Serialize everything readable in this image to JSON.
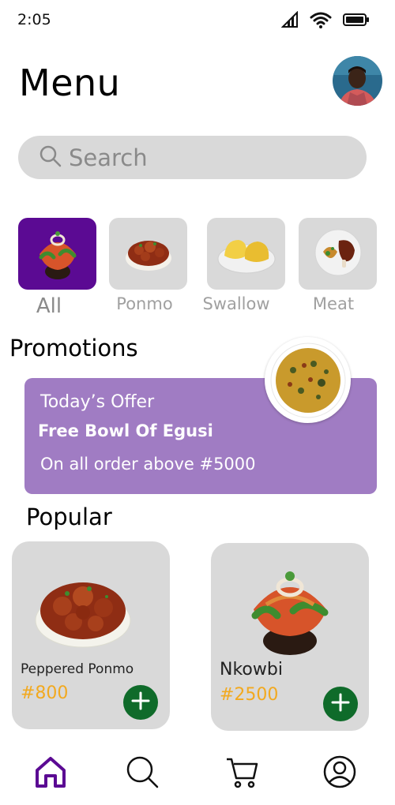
{
  "status_bar": {
    "time": "2:05",
    "icons": [
      "signal-icon",
      "wifi-icon",
      "battery-icon"
    ]
  },
  "header": {
    "title": "Menu",
    "avatar": "user-avatar"
  },
  "search": {
    "placeholder": "Search",
    "icon": "search-icon"
  },
  "categories": [
    {
      "label": "All",
      "active": true
    },
    {
      "label": "Ponmo",
      "active": false
    },
    {
      "label": "Swallow",
      "active": false
    },
    {
      "label": "Meat",
      "active": false
    }
  ],
  "promotions": {
    "title": "Promotions",
    "line1": "Today’s Offer",
    "line2": "Free Bowl Of Egusi",
    "line3": "On all order above #5000"
  },
  "popular": {
    "title": "Popular",
    "items": [
      {
        "name": "Peppered Ponmo",
        "price": "#800"
      },
      {
        "name": "Nkowbi",
        "price": "#2500"
      }
    ]
  },
  "bottom_nav": {
    "items": [
      "home-icon",
      "search-icon",
      "cart-icon",
      "profile-icon"
    ],
    "active": "home-icon"
  },
  "colors": {
    "accent": "#5b0a93",
    "promo": "#a07cc3",
    "price": "#f2a91f",
    "add_button": "#0f6b2a",
    "tile": "#d9d9d9"
  }
}
